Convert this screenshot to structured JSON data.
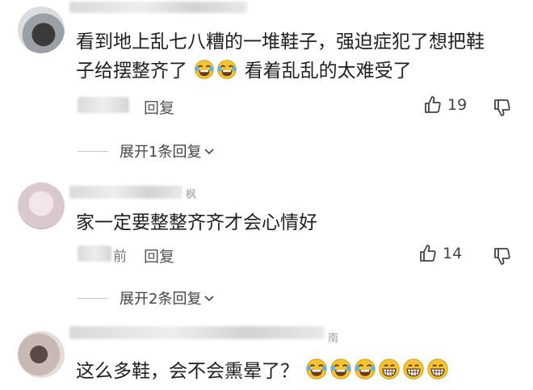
{
  "comments": [
    {
      "text_line1": "看到地上乱七八糟的一堆鞋子，强迫症犯了想把鞋",
      "text_line2": "子给摆整齐了",
      "text_after_emoji": "看着乱乱的太难受了",
      "emoji_after_line2": [
        "laughing-crying-emoji",
        "laughing-crying-emoji"
      ],
      "reply_label": "回复",
      "likes": "19"
    },
    {
      "name_suffix": "枫",
      "text": "家一定要整整齐齐才会心情好",
      "meta_suffix": "前",
      "reply_label": "回复",
      "likes": "14"
    },
    {
      "name_suffix": "南",
      "text": "这么多鞋，会不会熏晕了？",
      "emoji": [
        "laughing-crying-emoji",
        "laughing-crying-emoji",
        "laughing-crying-emoji",
        "grinning-emoji",
        "grinning-emoji",
        "grinning-emoji"
      ]
    }
  ],
  "expand_1": "展开1条回复",
  "expand_2": "展开2条回复",
  "icons": [
    "thumbs-up-icon",
    "thumbs-down-icon",
    "chevron-down-icon"
  ],
  "colors": {
    "text": "#1f1f1f",
    "meta": "#555555",
    "emoji_yellow": "#f6c431"
  }
}
